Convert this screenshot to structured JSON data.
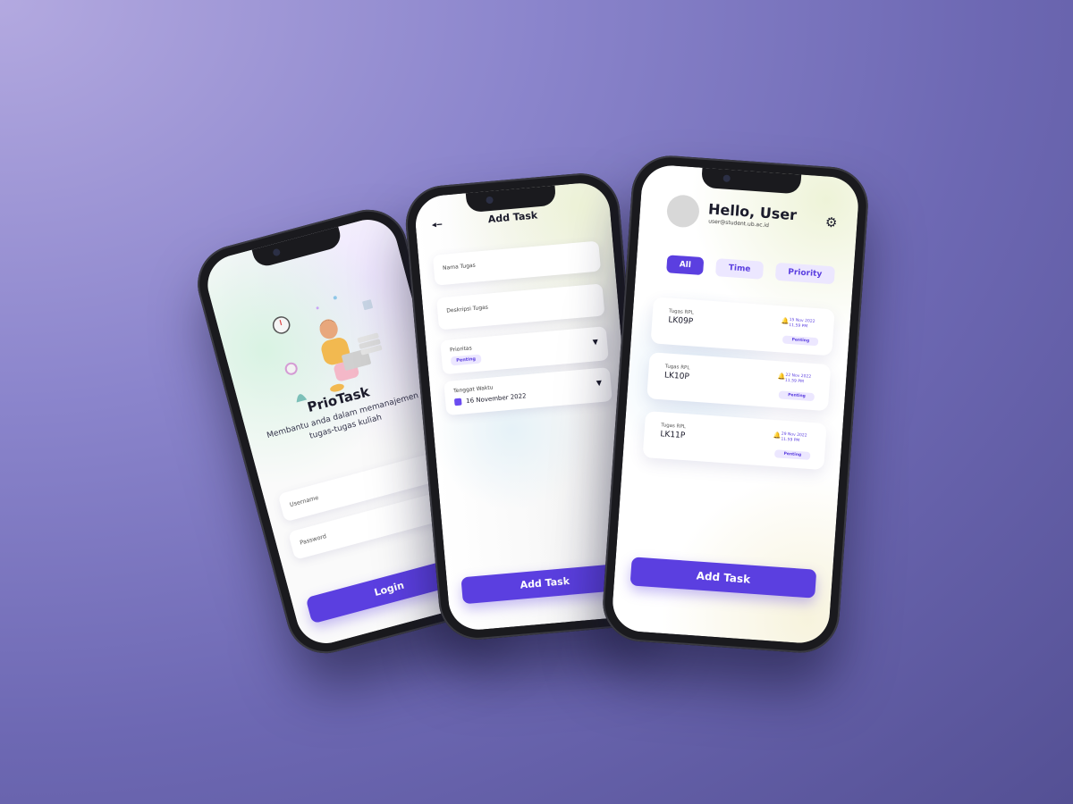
{
  "login": {
    "app_title": "PrioTask",
    "subtitle": "Membantu anda dalam memanajemen tugas-tugas kuliah",
    "username_label": "Username",
    "password_label": "Password",
    "login_button": "Login"
  },
  "add_task": {
    "title": "Add Task",
    "back_icon": "back-arrow-icon",
    "fields": {
      "name_label": "Nama Tugas",
      "description_label": "Deskripsi Tugas",
      "priority_label": "Prioritas",
      "priority_value": "Penting",
      "deadline_label": "Tenggat Waktu",
      "deadline_value": "16 November 2022"
    },
    "submit_button": "Add Task"
  },
  "home": {
    "greeting": "Hello, User",
    "email": "user@student.ub.ac.id",
    "settings_icon": "gear-icon",
    "filters": [
      {
        "label": "All",
        "active": true
      },
      {
        "label": "Time",
        "active": false
      },
      {
        "label": "Priority",
        "active": false
      }
    ],
    "tasks": [
      {
        "label": "Tugas RPL",
        "code": "LK09P",
        "date": "15 Nov 2022",
        "time": "11.59 PM",
        "status": "Penting"
      },
      {
        "label": "Tugas RPL",
        "code": "LK10P",
        "date": "22 Nov 2022",
        "time": "11.59 PM",
        "status": "Penting"
      },
      {
        "label": "Tugas RPL",
        "code": "LK11P",
        "date": "29 Nov 2022",
        "time": "11.59 PM",
        "status": "Penting"
      }
    ],
    "add_button": "Add Task"
  },
  "colors": {
    "accent": "#5b3fe0",
    "accent_light": "#ece7ff"
  }
}
